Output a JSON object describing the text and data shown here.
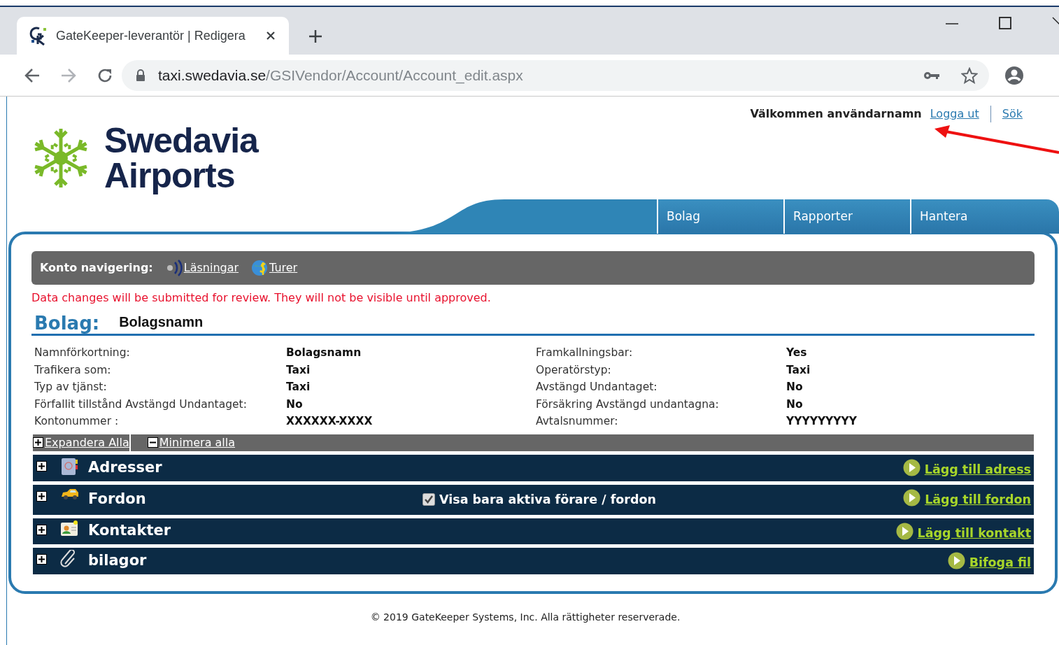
{
  "browser": {
    "tab_title": "GateKeeper-leverantör | Redigera",
    "url_host": "taxi.swedavia.se",
    "url_path": "/GSIVendor/Account/Account_edit.aspx"
  },
  "header": {
    "welcome": "Välkommen användarnamn",
    "links": [
      "Logga ut",
      "Sök"
    ]
  },
  "logo": {
    "line_1": "Swedavia",
    "line_2": "Airports"
  },
  "nav_tabs": [
    "Bolag",
    "Rapporter",
    "Hantera"
  ],
  "account_nav": {
    "label": "Konto navigering:",
    "links": [
      {
        "kind": "readings",
        "label": "Läsningar"
      },
      {
        "kind": "trips",
        "label": "Turer"
      }
    ]
  },
  "notice": "Data changes will be submitted for review. They will not be visible until approved.",
  "company": {
    "heading": "Bolag:",
    "name": "Bolagsnamn"
  },
  "details": [
    {
      "label": "Namnförkortning:",
      "value": "Bolagsnamn"
    },
    {
      "label": "Framkallningsbar:",
      "value": "Yes"
    },
    {
      "label": "Trafikera som:",
      "value": "Taxi"
    },
    {
      "label": "Operatörstyp:",
      "value": "Taxi"
    },
    {
      "label": "Typ av tjänst:",
      "value": "Taxi"
    },
    {
      "label": "Avstängd Undantaget:",
      "value": "No"
    },
    {
      "label": "Förfallit tillstånd Avstängd Undantaget:",
      "value": "No"
    },
    {
      "label": "Försäkring Avstängd undantagna:",
      "value": "No"
    },
    {
      "label": "Kontonummer :",
      "value": "XXXXXX-XXXX"
    },
    {
      "label": "Avtalsnummer:",
      "value": "YYYYYYYYY"
    }
  ],
  "toolbar": {
    "expand_all": "Expandera Alla",
    "collapse_all": "Minimera alla"
  },
  "sections": [
    {
      "kind": "addresses",
      "title": "Adresser",
      "expanded": false,
      "action": "Lägg till adress"
    },
    {
      "kind": "vehicles",
      "title": "Fordon",
      "expanded": false,
      "filter": {
        "label": "Visa bara aktiva förare / fordon",
        "checked": true
      },
      "action": "Lägg till fordon"
    },
    {
      "kind": "contacts",
      "title": "Kontakter",
      "expanded": false,
      "action": "Lägg till kontakt"
    },
    {
      "kind": "attachments",
      "title": "bilagor",
      "expanded": false,
      "action": "Bifoga fil"
    }
  ],
  "footer": "© 2019 GateKeeper Systems, Inc.  Alla rättigheter reserverade."
}
